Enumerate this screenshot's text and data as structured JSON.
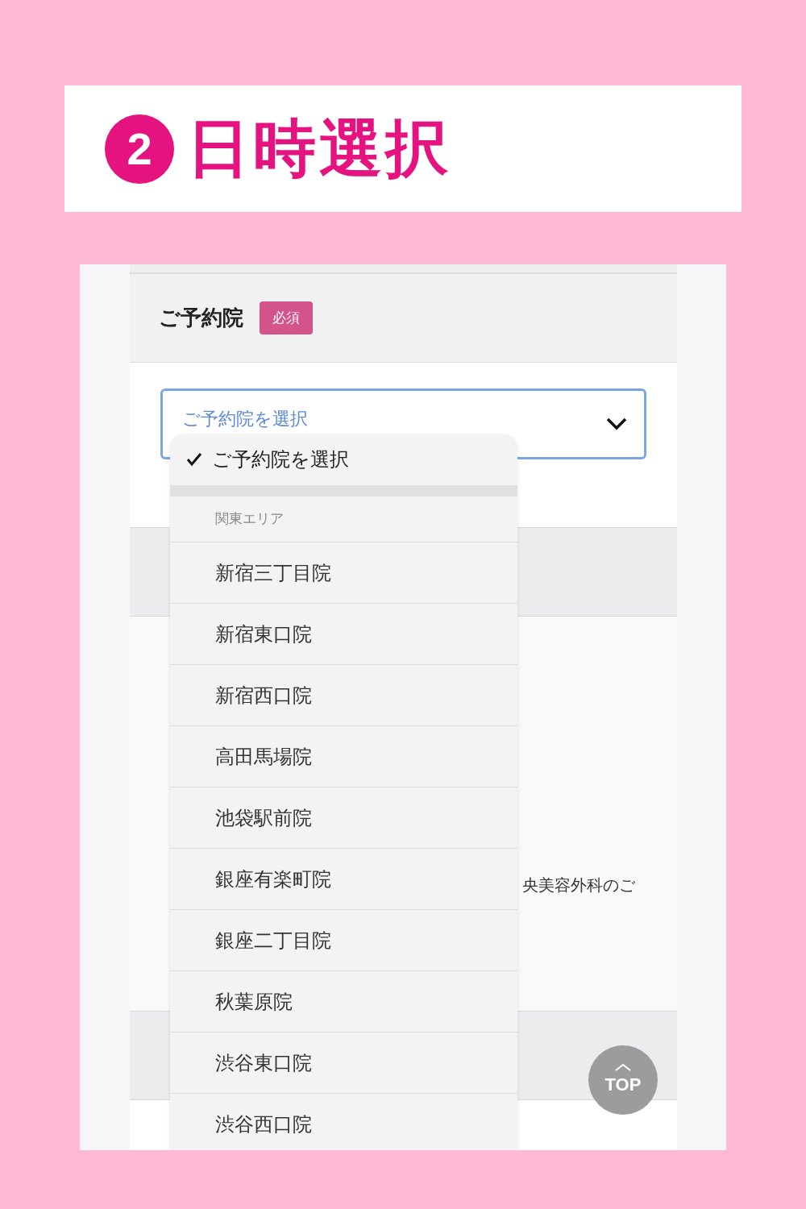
{
  "heading": {
    "step": "2",
    "title": "日時選択"
  },
  "form": {
    "label": "ご予約院",
    "badge": "必須",
    "select_value": "ご予約院を選択",
    "background_text": "央美容外科のご"
  },
  "dropdown": {
    "selected_option": {
      "label": "ご予約院を選択",
      "selected": true
    },
    "group_label": "関東エリア",
    "options": [
      {
        "label": "新宿三丁目院",
        "selected": false
      },
      {
        "label": "新宿東口院",
        "selected": false
      },
      {
        "label": "新宿西口院",
        "selected": false
      },
      {
        "label": "高田馬場院",
        "selected": false
      },
      {
        "label": "池袋駅前院",
        "selected": false
      },
      {
        "label": "銀座有楽町院",
        "selected": false
      },
      {
        "label": "銀座二丁目院",
        "selected": false
      },
      {
        "label": "秋葉原院",
        "selected": false
      },
      {
        "label": "渋谷東口院",
        "selected": false
      },
      {
        "label": "渋谷西口院",
        "selected": false
      }
    ]
  },
  "top_button": {
    "label": "TOP"
  }
}
